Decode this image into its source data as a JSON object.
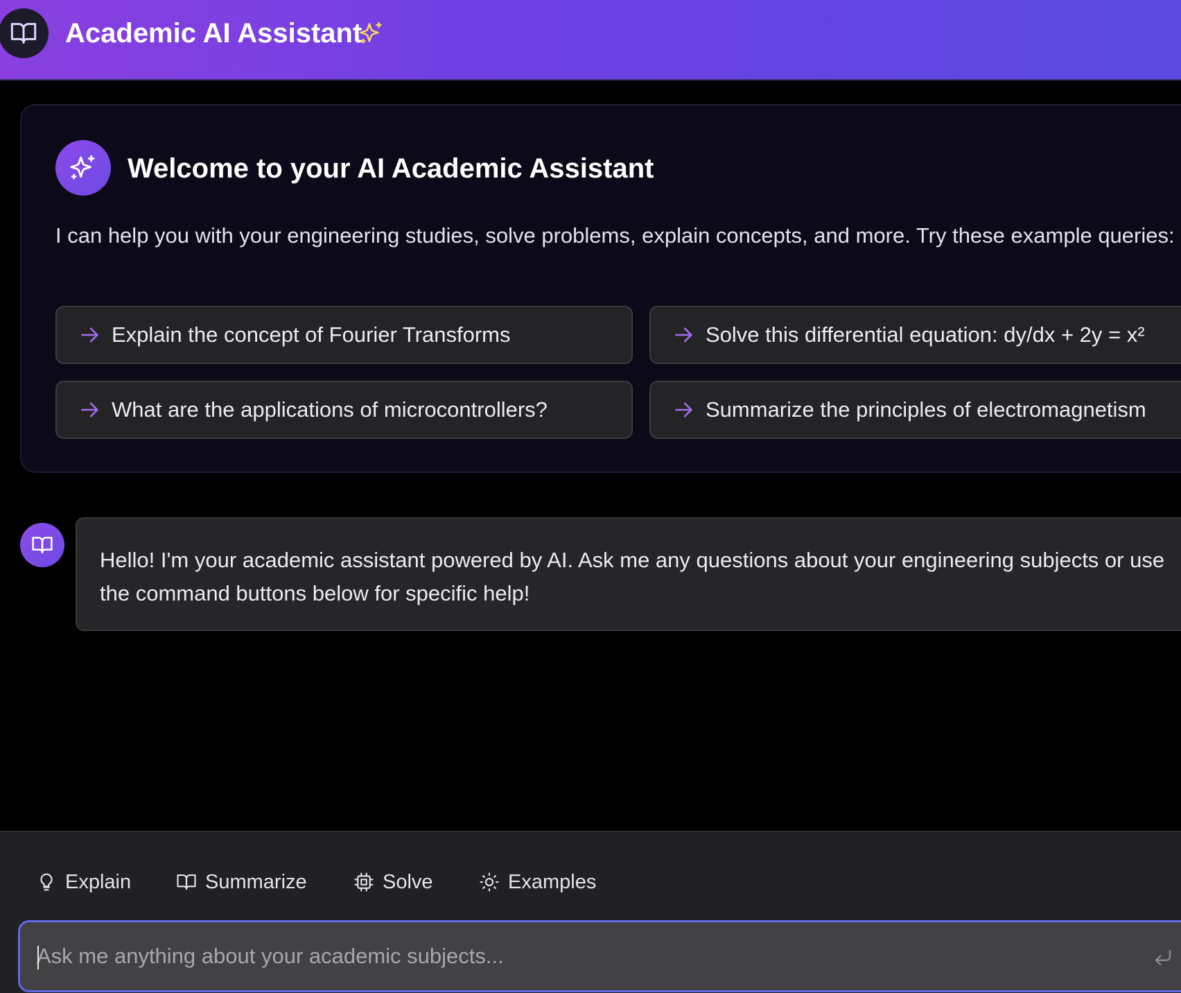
{
  "header": {
    "title": "Academic AI Assistant",
    "logo_icon": "book-open-icon",
    "sparkle_icon": "sparkles-icon"
  },
  "welcome": {
    "icon": "sparkles-icon",
    "title": "Welcome to your AI Academic Assistant",
    "description": "I can help you with your engineering studies, solve problems, explain concepts, and more. Try these example queries:",
    "examples": [
      "Explain the concept of Fourier Transforms",
      "Solve this differential equation: dy/dx + 2y = x²",
      "What are the applications of microcontrollers?",
      "Summarize the principles of electromagnetism"
    ]
  },
  "messages": [
    {
      "role": "assistant",
      "avatar_icon": "book-open-icon",
      "text": "Hello! I'm your academic assistant powered by AI. Ask me any questions about your engineering subjects or use the command buttons below for specific help!"
    }
  ],
  "commands": [
    {
      "label": "Explain",
      "icon": "lightbulb-icon"
    },
    {
      "label": "Summarize",
      "icon": "book-open-icon"
    },
    {
      "label": "Solve",
      "icon": "cpu-icon"
    },
    {
      "label": "Examples",
      "icon": "sun-icon"
    }
  ],
  "input": {
    "value": "",
    "placeholder": "Ask me anything about your academic subjects...",
    "submit_icon": "enter-icon"
  },
  "colors": {
    "header_gradient_start": "#8a3fe0",
    "header_gradient_end": "#5a4ae0",
    "accent_purple": "#8b4be8",
    "arrow_purple": "#a66cf2",
    "sparkle_yellow": "#f6d860",
    "input_focus_border": "#6368e6",
    "background": "#000000"
  }
}
